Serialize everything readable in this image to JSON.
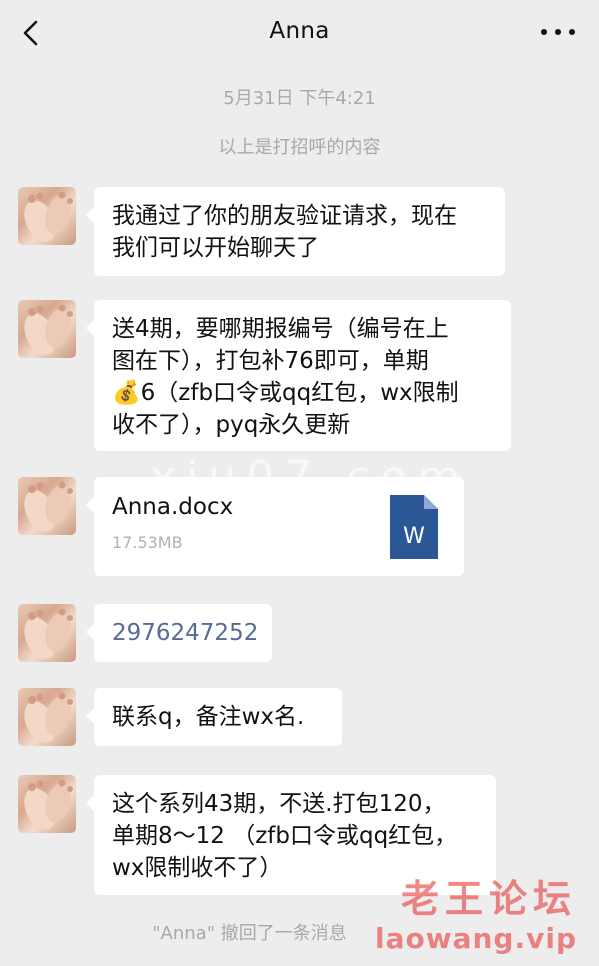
{
  "header": {
    "title": "Anna",
    "back_icon": "chevron-left-icon",
    "more_icon": "more-dots-icon"
  },
  "timestamp": "5月31日 下午4:21",
  "greeting_note": "以上是打招呼的内容",
  "messages": [
    {
      "type": "text",
      "text_lines": [
        "我通过了你的朋友验证请求，现在",
        "我们可以开始聊天了"
      ]
    },
    {
      "type": "text",
      "text_lines": [
        "送4期，要哪期报编号（编号在上",
        "图在下），打包补76即可，单期",
        "💰6（zfb口令或qq红包，wx限制",
        "收不了），pyq永久更新"
      ]
    },
    {
      "type": "file",
      "file_name": "Anna.docx",
      "file_size": "17.53MB",
      "file_icon": "word-file-icon",
      "icon_letter": "W"
    },
    {
      "type": "link",
      "text": "2976247252"
    },
    {
      "type": "text",
      "text_lines": [
        "联系q，备注wx名."
      ]
    },
    {
      "type": "text",
      "text_lines": [
        "这个系列43期，不送.打包120，",
        "单期8～12 （zfb口令或qq红包，",
        "wx限制收不了）"
      ]
    }
  ],
  "recall_note": "\"Anna\" 撤回了一条消息",
  "watermark": {
    "line1": "老王论坛",
    "line2": "laowang.vip"
  },
  "ghost_watermark": "xiu07.com",
  "colors": {
    "background": "#ededed",
    "bubble": "#ffffff",
    "link": "#576b95",
    "word_blue": "#2b5797",
    "watermark": "#e62828"
  }
}
